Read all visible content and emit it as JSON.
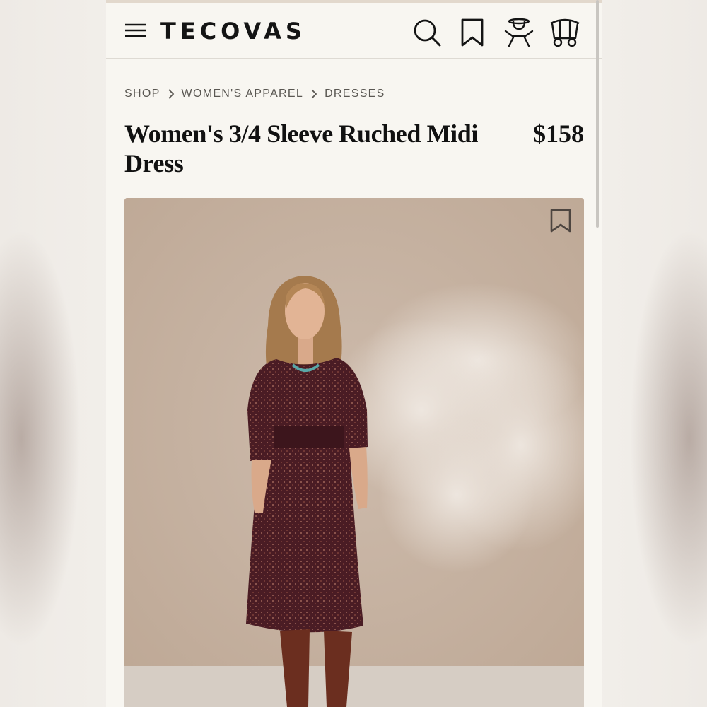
{
  "brand": {
    "logo": "TECOVAS"
  },
  "header": {
    "icons": [
      "menu-icon",
      "search-icon",
      "bookmark-icon",
      "account-icon",
      "cart-wagon-icon"
    ]
  },
  "breadcrumb": [
    {
      "label": "SHOP"
    },
    {
      "label": "WOMEN'S APPAREL"
    },
    {
      "label": "DRESSES"
    }
  ],
  "product": {
    "title": "Women's 3/4 Sleeve Ruched Midi Dress",
    "price": "$158",
    "dress_color": "#4a1c24",
    "boot_color": "#6b2e1f",
    "image_background": "#c7b3a2"
  },
  "colors": {
    "page_background": "#f8f6f1",
    "text_primary": "#111111",
    "text_secondary": "#5a5752"
  }
}
